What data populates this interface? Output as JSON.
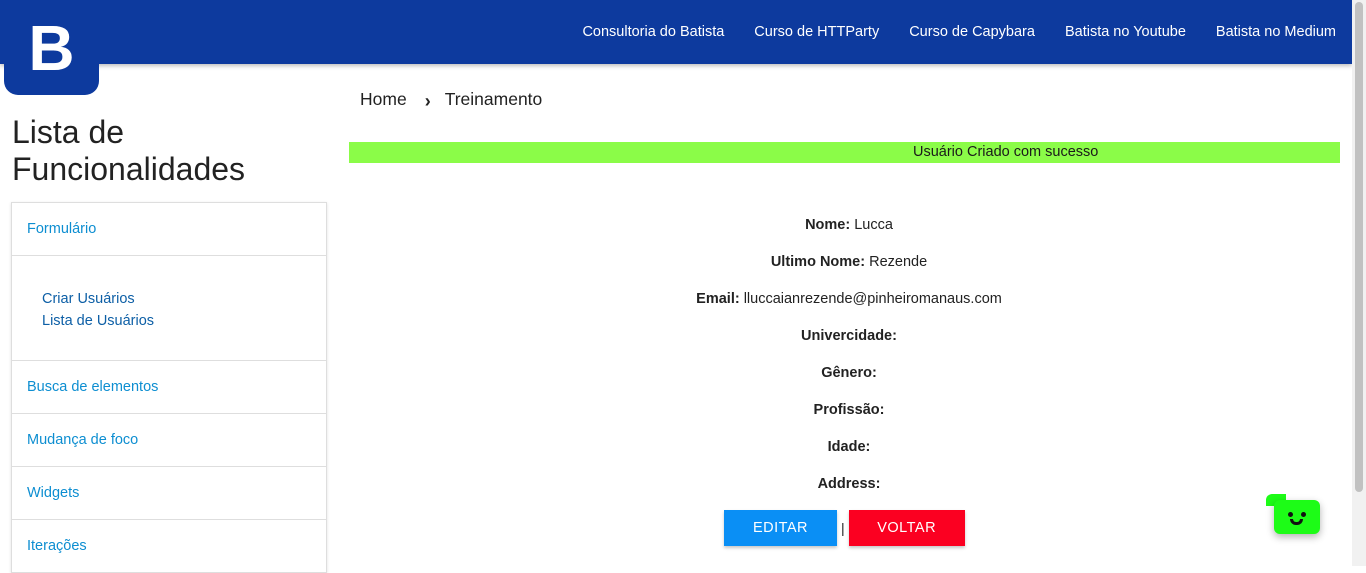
{
  "navbar": {
    "logo_letter": "B",
    "links": [
      "Consultoria do Batista",
      "Curso de HTTParty",
      "Curso de Capybara",
      "Batista no Youtube",
      "Batista no Medium"
    ]
  },
  "sidebar": {
    "title": "Lista de Funcionalidades",
    "sections": [
      {
        "label": "Formulário",
        "items": [
          "Criar Usuários",
          "Lista de Usuários"
        ]
      },
      {
        "label": "Busca de elementos"
      },
      {
        "label": "Mudança de foco"
      },
      {
        "label": "Widgets"
      },
      {
        "label": "Iterações"
      }
    ]
  },
  "breadcrumb": {
    "home": "Home",
    "separator": "›",
    "current": "Treinamento"
  },
  "banner": {
    "message": "Usuário Criado com sucesso",
    "color": "#8bfc48"
  },
  "details": [
    {
      "label": "Nome:",
      "value": "Lucca"
    },
    {
      "label": "Ultimo Nome:",
      "value": "Rezende"
    },
    {
      "label": "Email:",
      "value": "lluccaianrezende@pinheiromanaus.com"
    },
    {
      "label": "Univercidade:",
      "value": ""
    },
    {
      "label": "Gênero:",
      "value": ""
    },
    {
      "label": "Profissão:",
      "value": ""
    },
    {
      "label": "Idade:",
      "value": ""
    },
    {
      "label": "Address:",
      "value": ""
    }
  ],
  "actions": {
    "edit_label": "EDITAR",
    "separator": "|",
    "back_label": "VOLTAR",
    "edit_color": "#0a8ff5",
    "back_color": "#fb0021"
  },
  "chat_widget": {
    "icon": "smiley-chat-icon",
    "color": "#1dfc17"
  }
}
